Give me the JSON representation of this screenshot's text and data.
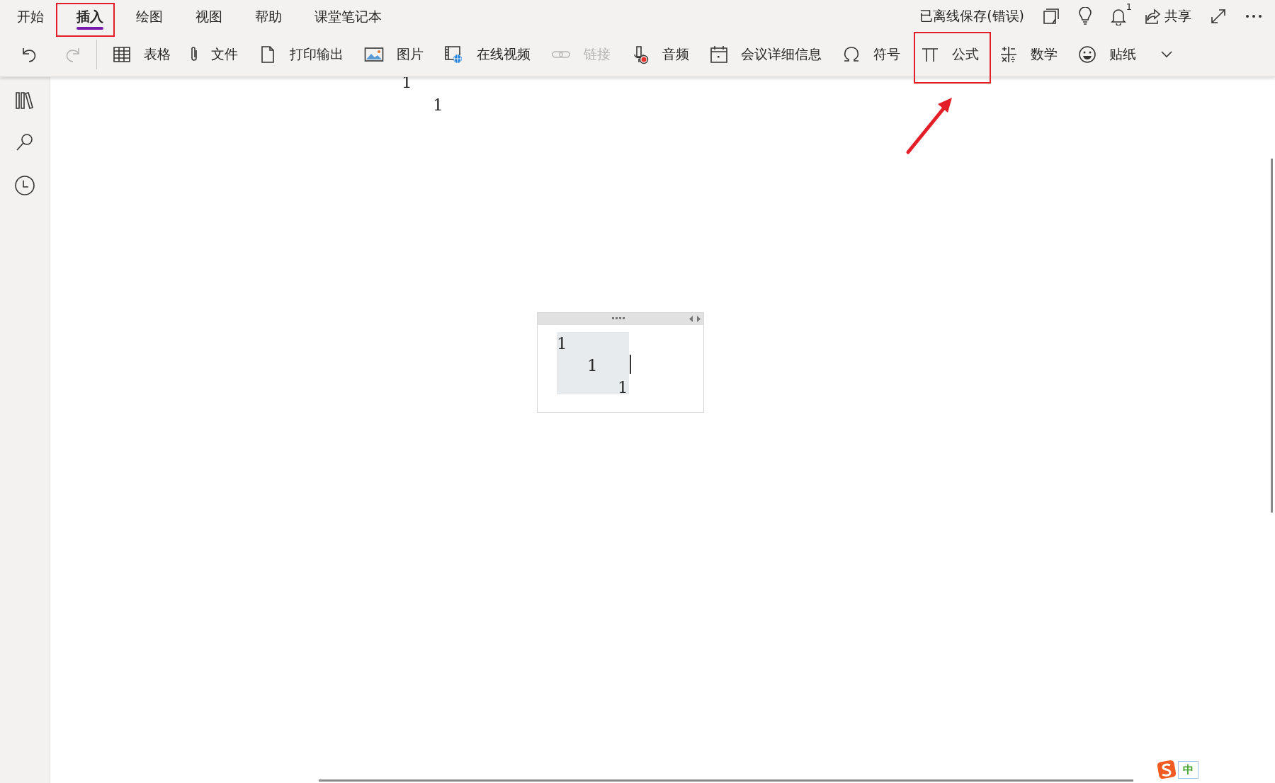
{
  "menu_tabs": [
    {
      "label": "开始",
      "selected": false
    },
    {
      "label": "插入",
      "selected": true
    },
    {
      "label": "绘图",
      "selected": false
    },
    {
      "label": "视图",
      "selected": false
    },
    {
      "label": "帮助",
      "selected": false
    },
    {
      "label": "课堂笔记本",
      "selected": false
    }
  ],
  "sync_status": "已离线保存(错误)",
  "notification_count": "1",
  "share_label": "共享",
  "history": [
    {
      "kind": "undo",
      "disabled": false
    },
    {
      "kind": "redo",
      "disabled": true
    }
  ],
  "toolbar": [
    {
      "kind": "table",
      "label": "表格",
      "disabled": false
    },
    {
      "kind": "file",
      "label": "文件",
      "disabled": false
    },
    {
      "kind": "printout",
      "label": "打印输出",
      "disabled": false
    },
    {
      "kind": "picture",
      "label": "图片",
      "disabled": false
    },
    {
      "kind": "video",
      "label": "在线视频",
      "disabled": false
    },
    {
      "kind": "link",
      "label": "链接",
      "disabled": true
    },
    {
      "kind": "audio",
      "label": "音频",
      "disabled": false
    },
    {
      "kind": "meeting",
      "label": "会议详细信息",
      "disabled": false
    },
    {
      "kind": "symbol",
      "label": "符号",
      "disabled": false
    },
    {
      "kind": "equation",
      "label": "公式",
      "disabled": false
    },
    {
      "kind": "math",
      "label": "数学",
      "disabled": false
    },
    {
      "kind": "sticker",
      "label": "贴纸",
      "disabled": false
    }
  ],
  "page": {
    "lines": [
      "1",
      "1"
    ]
  },
  "math_container": {
    "lines": [
      "1",
      "1",
      "1"
    ]
  },
  "ime": {
    "mode": "中"
  }
}
